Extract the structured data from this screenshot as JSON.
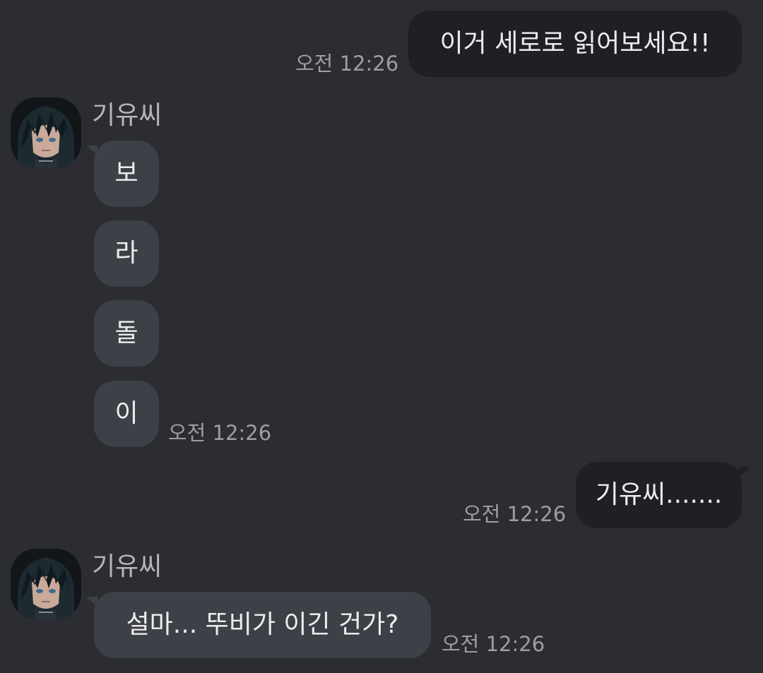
{
  "colors": {
    "background": "#2b2d33",
    "outgoing_bubble": "#1f2025",
    "incoming_bubble": "#3e4047",
    "timestamp": "#9c9ea4",
    "sender_name": "#b4b6bb",
    "message_text": "#ececee"
  },
  "messages": [
    {
      "direction": "outgoing",
      "text": "이거 세로로 읽어보세요!!",
      "time": "오전 12:26"
    },
    {
      "direction": "incoming",
      "sender": "기유씨",
      "avatar_icon": "anime-character-avatar-icon",
      "text": "보"
    },
    {
      "direction": "incoming",
      "text": "라"
    },
    {
      "direction": "incoming",
      "text": "돌"
    },
    {
      "direction": "incoming",
      "text": "이",
      "time": "오전 12:26"
    },
    {
      "direction": "outgoing",
      "text": "기유씨.......",
      "time": "오전 12:26"
    },
    {
      "direction": "incoming",
      "sender": "기유씨",
      "avatar_icon": "anime-character-avatar-icon",
      "text": "설마... 뚜비가 이긴 건가?",
      "time": "오전 12:26"
    }
  ]
}
